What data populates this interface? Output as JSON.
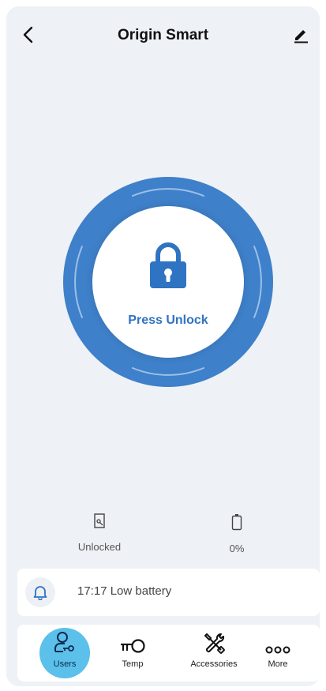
{
  "header": {
    "title": "Origin Smart",
    "back_icon": "chevron-left-icon",
    "edit_icon": "pencil-icon"
  },
  "lock": {
    "action_label": "Press Unlock",
    "icon": "padlock-icon",
    "ring_color": "#3e80c9",
    "label_color": "#2f73c3"
  },
  "status": {
    "lock_state": "Unlocked",
    "lock_state_icon": "door-sensor-icon",
    "battery_level": "0%",
    "battery_icon": "battery-icon"
  },
  "alert": {
    "icon": "bell-icon",
    "text": "17:17 Low battery"
  },
  "nav": {
    "items": [
      {
        "label": "Users",
        "icon": "user-key-icon",
        "active": true
      },
      {
        "label": "Temp",
        "icon": "temp-key-icon",
        "active": false
      },
      {
        "label": "Accessories",
        "icon": "tools-icon",
        "active": false
      },
      {
        "label": "More",
        "icon": "more-dots-icon",
        "active": false
      }
    ],
    "active_color": "#5bc0ea"
  }
}
